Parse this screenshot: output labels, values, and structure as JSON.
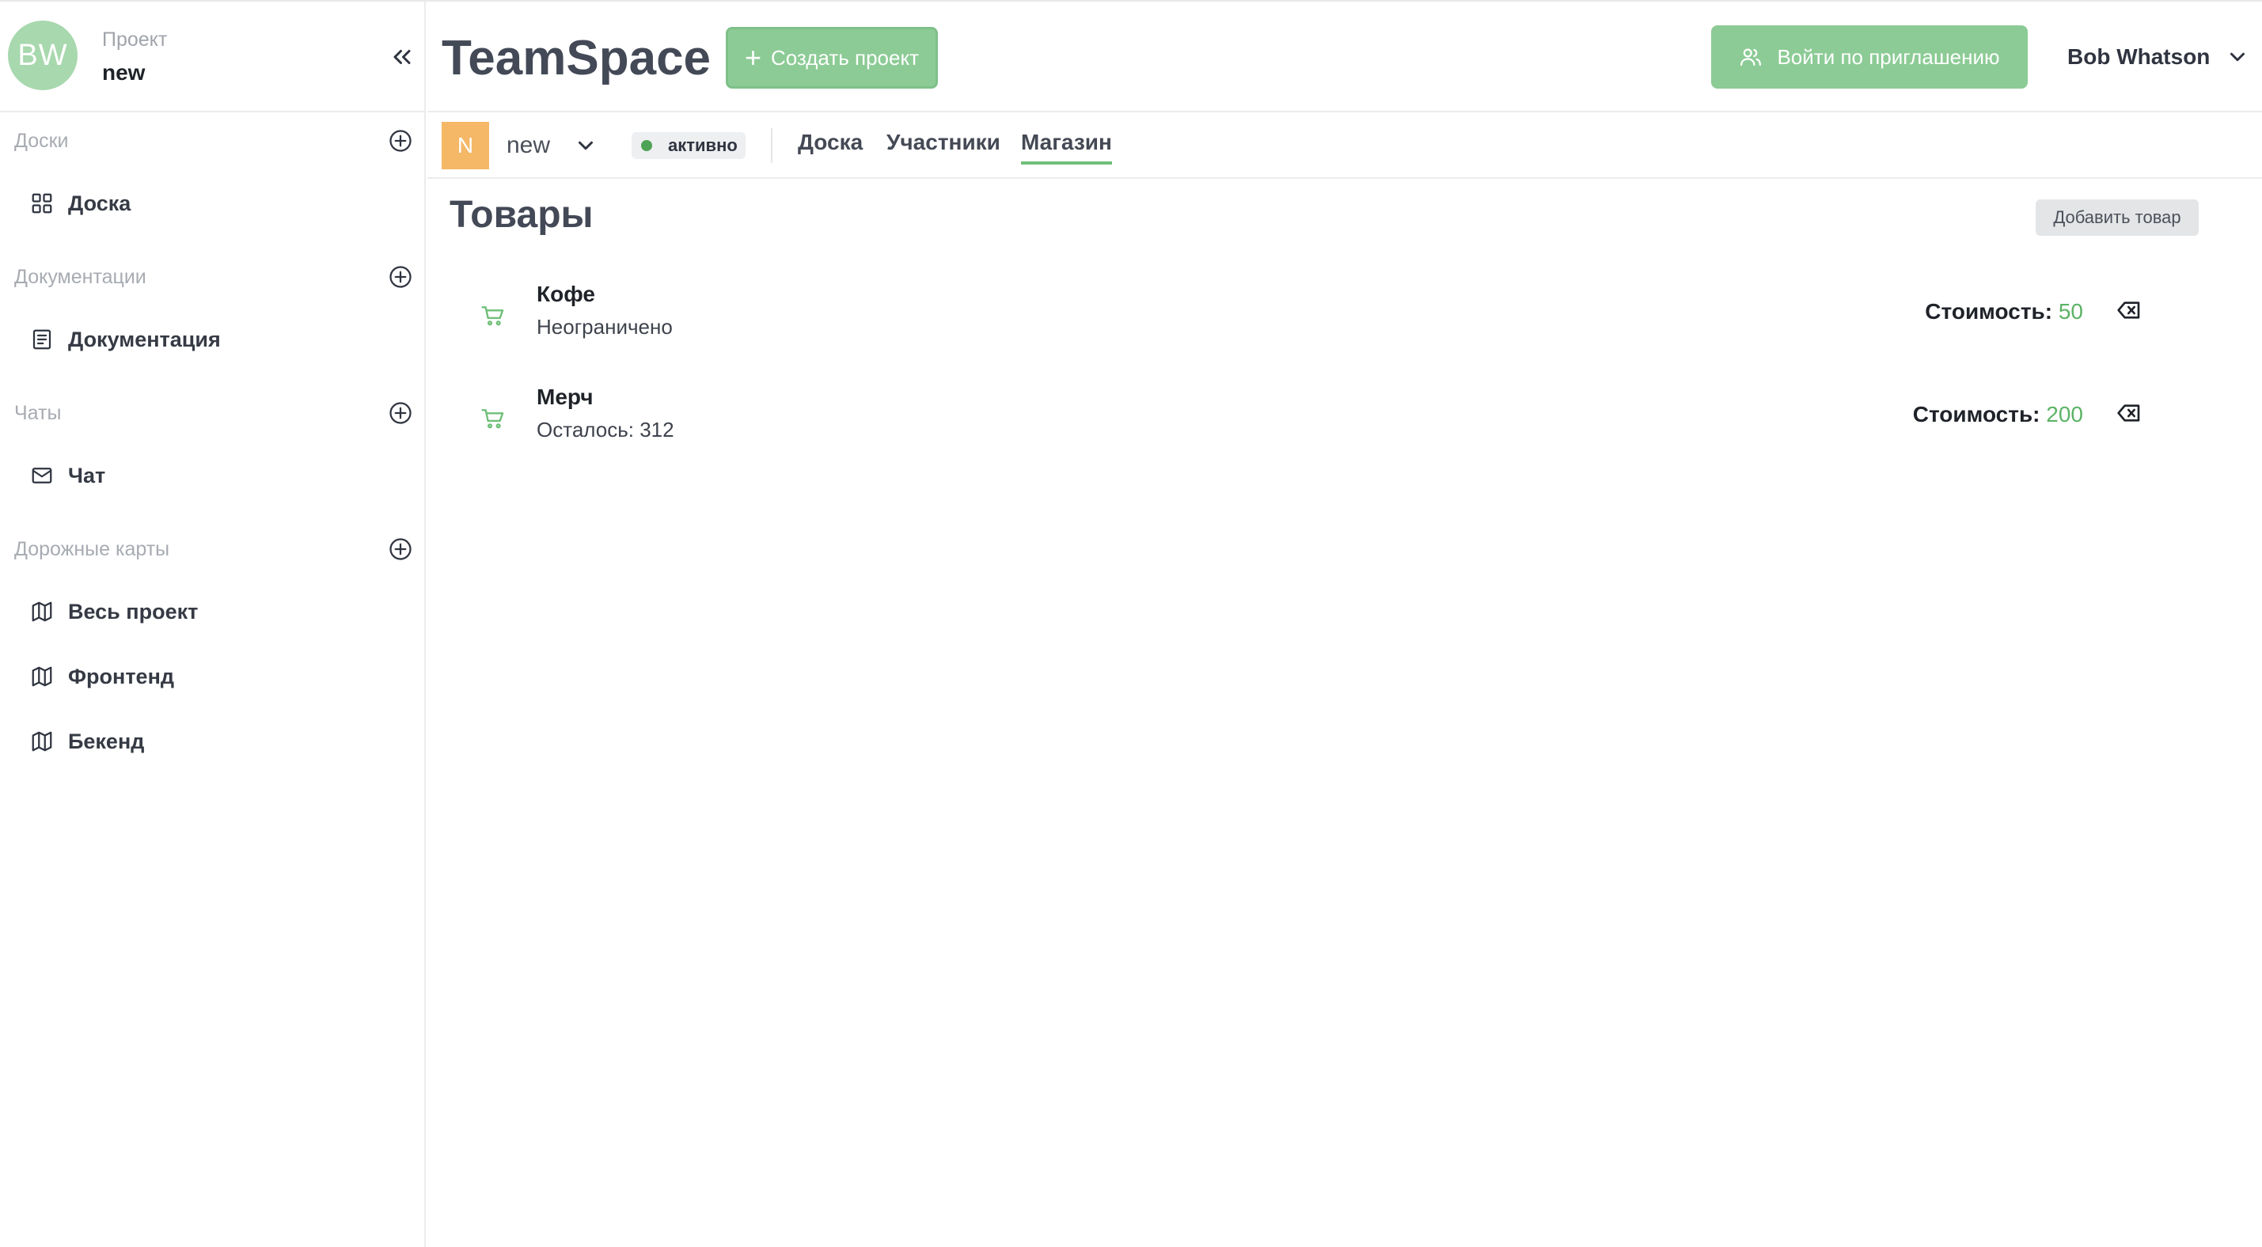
{
  "sidebar": {
    "avatar_initials": "BW",
    "project_caption": "Проект",
    "project_name": "new",
    "sections": [
      {
        "title": "Доски",
        "items": [
          {
            "label": "Доска",
            "icon": "grid-icon"
          }
        ]
      },
      {
        "title": "Документации",
        "items": [
          {
            "label": "Документация",
            "icon": "document-icon"
          }
        ]
      },
      {
        "title": "Чаты",
        "items": [
          {
            "label": "Чат",
            "icon": "mail-icon"
          }
        ]
      },
      {
        "title": "Дорожные карты",
        "items": [
          {
            "label": "Весь проект",
            "icon": "map-icon"
          },
          {
            "label": "Фронтенд",
            "icon": "map-icon"
          },
          {
            "label": "Бекенд",
            "icon": "map-icon"
          }
        ]
      }
    ]
  },
  "header": {
    "brand": "TeamSpace",
    "create_label": "Создать проект",
    "invite_label": "Войти по приглашению",
    "user_name": "Bob Whatson"
  },
  "subheader": {
    "badge_letter": "N",
    "project_name": "new",
    "status": "активно",
    "tabs": [
      "Доска",
      "Участники",
      "Магазин"
    ],
    "active_tab": "Магазин"
  },
  "main": {
    "title": "Товары",
    "add_label": "Добавить товар",
    "price_label": "Стоимость:",
    "products": [
      {
        "name": "Кофе",
        "stock": "Неограничено",
        "price": "50"
      },
      {
        "name": "Мерч",
        "stock": "Осталось: 312",
        "price": "200"
      }
    ]
  },
  "colors": {
    "accent_green": "#8ccb95",
    "price_green": "#5cb366",
    "badge_orange": "#f4b867",
    "status_dot": "#4ea356"
  }
}
